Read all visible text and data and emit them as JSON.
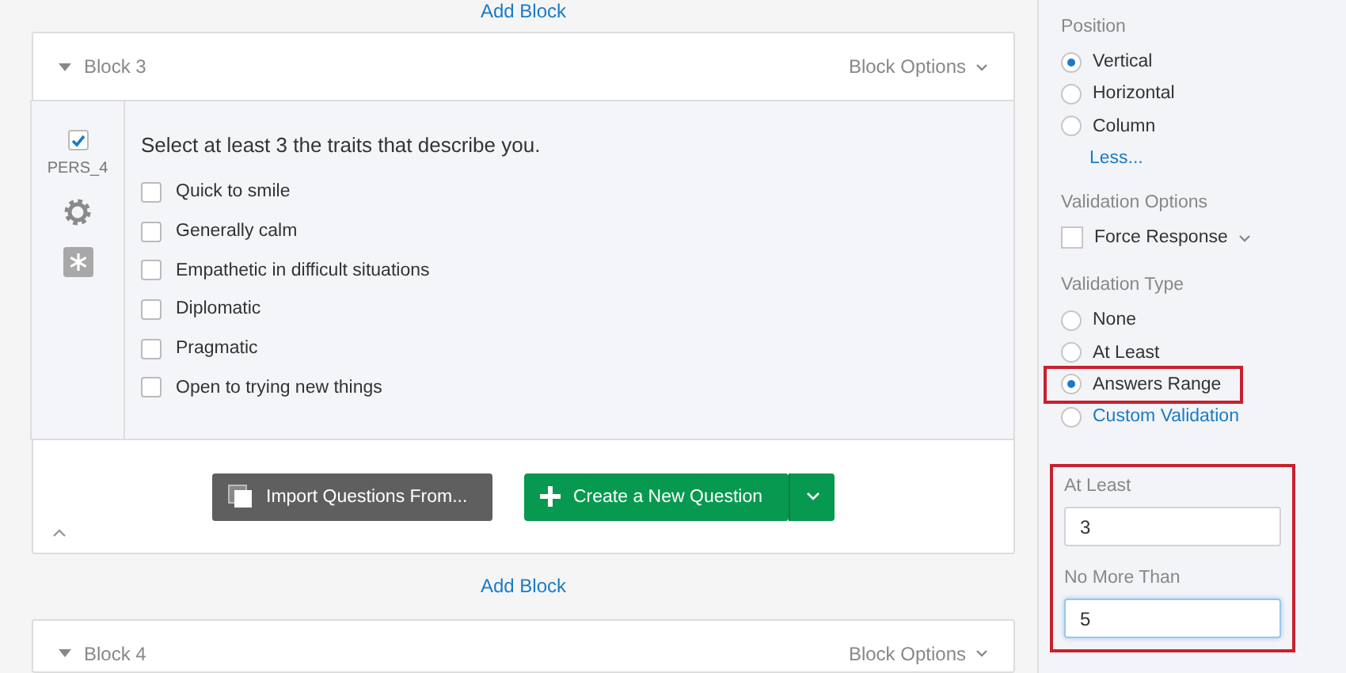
{
  "top_link": "Add Block",
  "block": {
    "title": "Block 3",
    "options": "Block Options"
  },
  "question": {
    "selected": true,
    "id": "PERS_4",
    "text": "Select at least 3 the traits that describe you.",
    "choices": [
      {
        "label": "Quick to smile",
        "checked": false
      },
      {
        "label": "Generally calm",
        "checked": false
      },
      {
        "label": "Empathetic in difficult situations",
        "checked": false
      },
      {
        "label": "Diplomatic",
        "checked": false
      },
      {
        "label": "Pragmatic",
        "checked": false
      },
      {
        "label": "Open to trying new things",
        "checked": false
      }
    ]
  },
  "buttons": {
    "import": "Import Questions From...",
    "create": "Create a New Question"
  },
  "add_block": "Add Block",
  "next_block": {
    "title": "Block 4",
    "options": "Block Options"
  },
  "panel": {
    "position": {
      "label": "Position",
      "options": [
        {
          "label": "Vertical",
          "selected": true
        },
        {
          "label": "Horizontal",
          "selected": false
        },
        {
          "label": "Column",
          "selected": false
        }
      ],
      "less": "Less..."
    },
    "validation_options": {
      "label": "Validation Options",
      "force_response": {
        "label": "Force Response",
        "checked": false
      }
    },
    "validation_type": {
      "label": "Validation Type",
      "options": [
        {
          "label": "None",
          "selected": false,
          "kind": "option",
          "highlighted": false
        },
        {
          "label": "At Least",
          "selected": false,
          "kind": "option",
          "highlighted": false
        },
        {
          "label": "Answers Range",
          "selected": true,
          "kind": "option",
          "highlighted": true
        },
        {
          "label": "Custom Validation",
          "selected": false,
          "kind": "link",
          "highlighted": false
        }
      ]
    },
    "range_fields": {
      "highlighted": true,
      "fields": [
        {
          "label": "At Least",
          "value": "3",
          "focused": false
        },
        {
          "label": "No More Than",
          "value": "5",
          "focused": true
        }
      ]
    }
  }
}
